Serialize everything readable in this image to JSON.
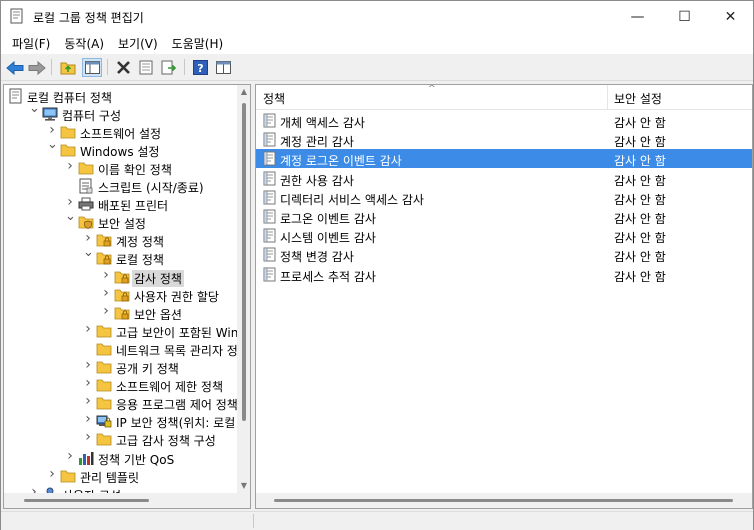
{
  "window": {
    "title": "로컬 그룹 정책 편집기",
    "minimize": "—",
    "maximize": "☐",
    "close": "✕"
  },
  "menu": [
    "파일(F)",
    "동작(A)",
    "보기(V)",
    "도움말(H)"
  ],
  "toolbar": [
    "back-icon",
    "forward-icon",
    "up-folder-icon",
    "show-hide-tree-icon",
    "delete-icon",
    "properties-icon",
    "export-icon",
    "help-icon",
    "view-icon"
  ],
  "tree": [
    {
      "label": "로컬 컴퓨터 정책",
      "indent": 0,
      "chevron": "",
      "icon": "policy-doc-icon"
    },
    {
      "label": "컴퓨터 구성",
      "indent": 1,
      "chevron": "down",
      "icon": "computer-icon"
    },
    {
      "label": "소프트웨어 설정",
      "indent": 2,
      "chevron": "right",
      "icon": "folder-icon"
    },
    {
      "label": "Windows 설정",
      "indent": 2,
      "chevron": "down",
      "icon": "folder-icon"
    },
    {
      "label": "이름 확인 정책",
      "indent": 3,
      "chevron": "right",
      "icon": "folder-icon"
    },
    {
      "label": "스크립트 (시작/종료)",
      "indent": 3,
      "chevron": "",
      "icon": "script-icon"
    },
    {
      "label": "배포된 프린터",
      "indent": 3,
      "chevron": "right",
      "icon": "printer-icon"
    },
    {
      "label": "보안 설정",
      "indent": 3,
      "chevron": "down",
      "icon": "security-icon"
    },
    {
      "label": "계정 정책",
      "indent": 4,
      "chevron": "right",
      "icon": "locked-folder-icon"
    },
    {
      "label": "로컬 정책",
      "indent": 4,
      "chevron": "down",
      "icon": "locked-folder-icon"
    },
    {
      "label": "감사 정책",
      "indent": 5,
      "chevron": "right",
      "icon": "locked-folder-icon",
      "selected": true
    },
    {
      "label": "사용자 권한 할당",
      "indent": 5,
      "chevron": "right",
      "icon": "locked-folder-icon"
    },
    {
      "label": "보안 옵션",
      "indent": 5,
      "chevron": "right",
      "icon": "locked-folder-icon"
    },
    {
      "label": "고급 보안이 포함된 Win",
      "indent": 4,
      "chevron": "right",
      "icon": "folder-icon"
    },
    {
      "label": "네트워크 목록 관리자 정",
      "indent": 4,
      "chevron": "",
      "icon": "folder-icon"
    },
    {
      "label": "공개 키 정책",
      "indent": 4,
      "chevron": "right",
      "icon": "folder-icon"
    },
    {
      "label": "소프트웨어 제한 정책",
      "indent": 4,
      "chevron": "right",
      "icon": "folder-icon"
    },
    {
      "label": "응용 프로그램 제어 정책",
      "indent": 4,
      "chevron": "right",
      "icon": "folder-icon"
    },
    {
      "label": "IP 보안 정책(위치: 로컬",
      "indent": 4,
      "chevron": "right",
      "icon": "ip-security-icon"
    },
    {
      "label": "고급 감사 정책 구성",
      "indent": 4,
      "chevron": "right",
      "icon": "folder-icon"
    },
    {
      "label": "정책 기반 QoS",
      "indent": 3,
      "chevron": "right",
      "icon": "qos-chart-icon"
    },
    {
      "label": "관리 템플릿",
      "indent": 2,
      "chevron": "right",
      "icon": "folder-icon"
    },
    {
      "label": "사용자 구성",
      "indent": 1,
      "chevron": "right",
      "icon": "user-icon"
    }
  ],
  "list": {
    "headers": {
      "policy": "정책",
      "setting": "보안 설정"
    },
    "sort_arrow": "^",
    "rows": [
      {
        "policy": "개체 액세스 감사",
        "setting": "감사 안 함"
      },
      {
        "policy": "계정 관리 감사",
        "setting": "감사 안 함"
      },
      {
        "policy": "계정 로그온 이벤트 감사",
        "setting": "감사 안 함",
        "selected": true
      },
      {
        "policy": "권한 사용 감사",
        "setting": "감사 안 함"
      },
      {
        "policy": "디렉터리 서비스 액세스 감사",
        "setting": "감사 안 함"
      },
      {
        "policy": "로그온 이벤트 감사",
        "setting": "감사 안 함"
      },
      {
        "policy": "시스템 이벤트 감사",
        "setting": "감사 안 함"
      },
      {
        "policy": "정책 변경 감사",
        "setting": "감사 안 함"
      },
      {
        "policy": "프로세스 추적 감사",
        "setting": "감사 안 함"
      }
    ]
  },
  "colors": {
    "selection": "#3c8ce7",
    "tree_selection": "#d9d9d9",
    "folder": "#f5c542"
  }
}
